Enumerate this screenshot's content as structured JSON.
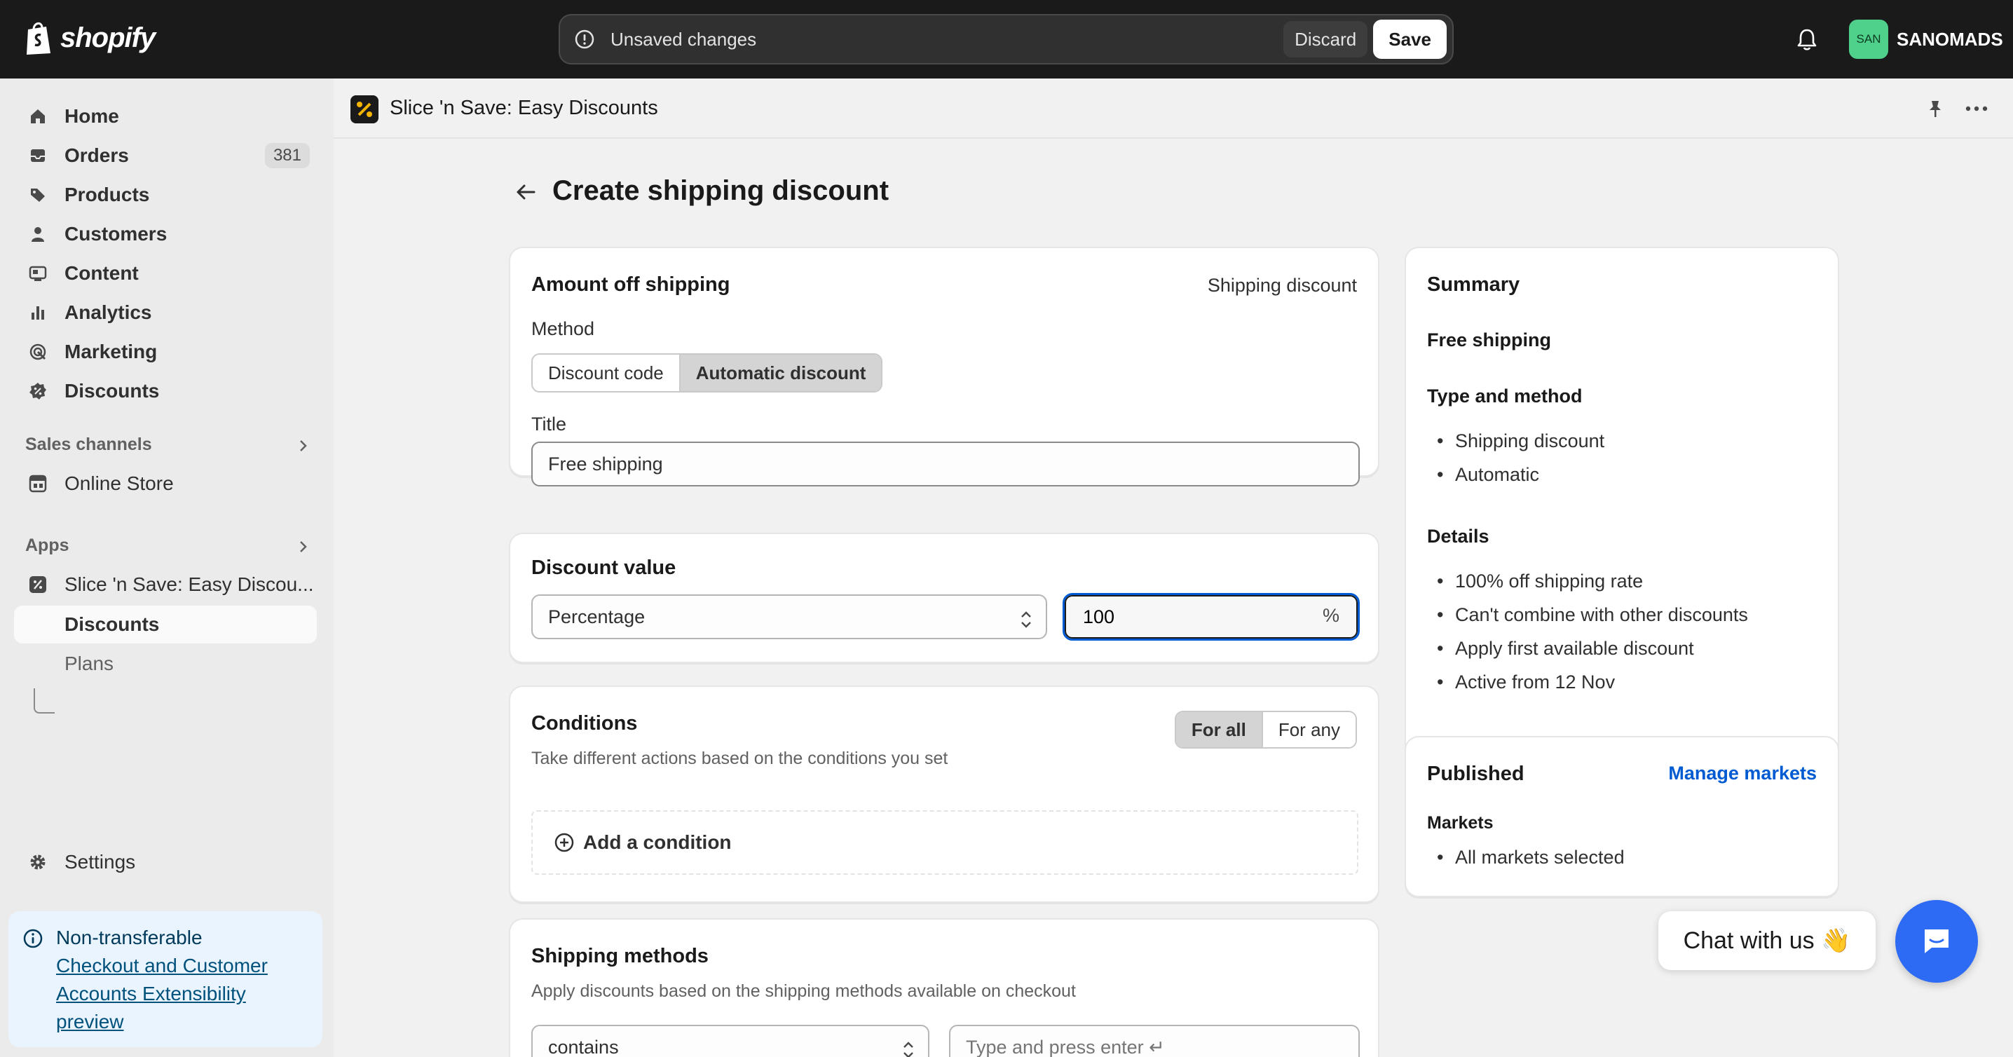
{
  "topbar": {
    "brand": "shopify",
    "unsaved_text": "Unsaved changes",
    "discard_label": "Discard",
    "save_label": "Save",
    "store_initials": "SAN",
    "store_name": "SANOMADS"
  },
  "sidebar": {
    "items": [
      {
        "label": "Home",
        "icon": "home-icon"
      },
      {
        "label": "Orders",
        "icon": "inbox-icon",
        "badge": "381"
      },
      {
        "label": "Products",
        "icon": "tag-icon"
      },
      {
        "label": "Customers",
        "icon": "person-icon"
      },
      {
        "label": "Content",
        "icon": "content-icon"
      },
      {
        "label": "Analytics",
        "icon": "bar-chart-icon"
      },
      {
        "label": "Marketing",
        "icon": "target-icon"
      },
      {
        "label": "Discounts",
        "icon": "discount-icon"
      }
    ],
    "sales_channels_title": "Sales channels",
    "online_store": "Online Store",
    "apps_title": "Apps",
    "app_name": "Slice 'n Save: Easy Discou...",
    "app_sub_discounts": "Discounts",
    "app_sub_plans": "Plans",
    "settings": "Settings",
    "notice": {
      "line1": "Non-transferable",
      "link": "Checkout and Customer Accounts Extensibility preview"
    }
  },
  "app_header": {
    "title": "Slice 'n Save: Easy Discounts"
  },
  "page": {
    "title": "Create shipping discount"
  },
  "amount_card": {
    "title": "Amount off shipping",
    "type_label": "Shipping discount",
    "method_label": "Method",
    "method_options": [
      "Discount code",
      "Automatic discount"
    ],
    "method_selected": "Automatic discount",
    "title_label": "Title",
    "title_value": "Free shipping"
  },
  "value_card": {
    "title": "Discount value",
    "type_selected": "Percentage",
    "amount": "100",
    "suffix": "%"
  },
  "conditions_card": {
    "title": "Conditions",
    "description": "Take different actions based on the conditions you set",
    "toggle_options": [
      "For all",
      "For any"
    ],
    "toggle_selected": "For all",
    "add_label": "Add a condition"
  },
  "shipping_card": {
    "title": "Shipping methods",
    "description": "Apply discounts based on the shipping methods available on checkout",
    "operator_selected": "contains",
    "input_placeholder": "Type and press enter ↵"
  },
  "summary": {
    "title": "Summary",
    "discount_title": "Free shipping",
    "type_heading": "Type and method",
    "type_items": [
      "Shipping discount",
      "Automatic"
    ],
    "details_heading": "Details",
    "details_items": [
      "100% off shipping rate",
      "Can't combine with other discounts",
      "Apply first available discount",
      "Active from 12 Nov"
    ]
  },
  "published": {
    "title": "Published",
    "manage_link": "Manage markets",
    "markets_heading": "Markets",
    "markets_items": [
      "All markets selected"
    ]
  },
  "chat": {
    "label": "Chat with us 👋"
  },
  "colors": {
    "topbar_bg": "#1a1a1a",
    "accent_blue": "#005bd3",
    "chat_blue": "#2d6bf5",
    "avatar_green": "#4fd18b"
  }
}
